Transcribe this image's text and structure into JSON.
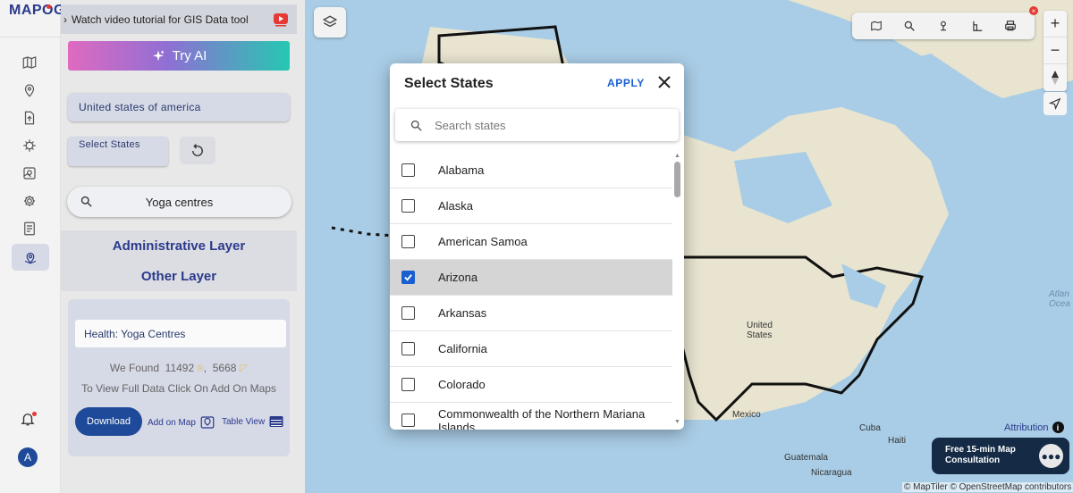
{
  "app": {
    "logo": "MAPOG"
  },
  "rail": {
    "icons": [
      "map-icon",
      "location-pin-icon",
      "upload-icon",
      "bug-icon",
      "map-layers-icon",
      "gear-icon",
      "report-icon",
      "data-icon"
    ],
    "avatar_initial": "A"
  },
  "panel": {
    "tutorial": "Watch video tutorial for GIS Data tool",
    "try_ai": "Try AI",
    "country": "United states of america",
    "select_states": "Select States",
    "search_value": "Yoga centres",
    "administrative_layer": "Administrative Layer",
    "other_layer": "Other Layer",
    "found": {
      "category": "Health: Yoga Centres",
      "prefix": "We Found",
      "count_points": "11492",
      "count_other": "5668",
      "hint": "To View Full Data Click On Add On Maps",
      "download": "Download",
      "add_on_map": "Add on Map",
      "table_view": "Table View"
    }
  },
  "map": {
    "labels": {
      "united_states": "United\nStates",
      "mexico": "Mexico",
      "cuba": "Cuba",
      "haiti": "Haiti",
      "guatemala": "Guatemala",
      "nicaragua": "Nicaragua",
      "atlantic": "Atlan\nOcea"
    },
    "attribution": "Attribution",
    "consultation": "Free 15-min Map Consultation",
    "copyright": "© MapTiler © OpenStreetMap contributors",
    "zoom_in": "+",
    "zoom_out": "−"
  },
  "modal": {
    "title": "Select States",
    "apply": "APPLY",
    "search_placeholder": "Search states",
    "states": [
      {
        "name": "Alabama",
        "checked": false
      },
      {
        "name": "Alaska",
        "checked": false
      },
      {
        "name": "American Samoa",
        "checked": false
      },
      {
        "name": "Arizona",
        "checked": true
      },
      {
        "name": "Arkansas",
        "checked": false
      },
      {
        "name": "California",
        "checked": false
      },
      {
        "name": "Colorado",
        "checked": false
      },
      {
        "name": "Commonwealth of the Northern Mariana Islands",
        "checked": false
      }
    ]
  },
  "colors": {
    "brand": "#2a3a8c",
    "accent": "#1a5fd0",
    "water": "#a9cde6",
    "land": "#e8e4d0"
  }
}
